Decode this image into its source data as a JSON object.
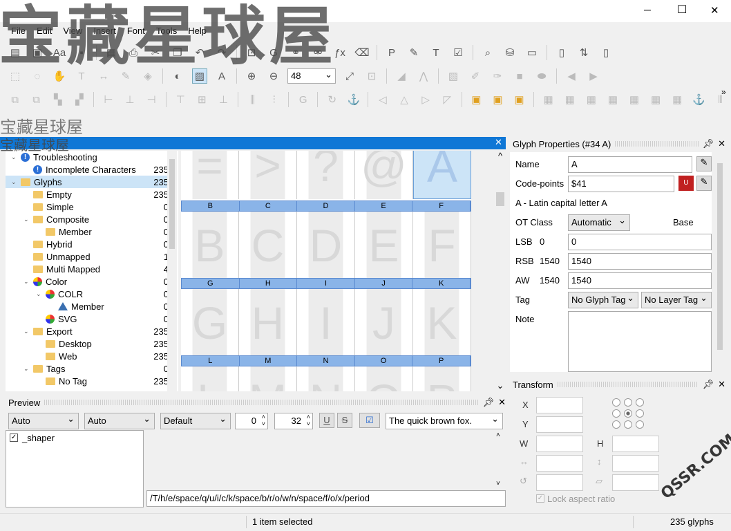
{
  "watermark": {
    "big": "宝藏星球屋",
    "small1": "宝藏星球屋",
    "small2": "宝藏星球屋",
    "corner": "QSSR.COM"
  },
  "window": {
    "min": "─",
    "max": "☐",
    "close": "✕"
  },
  "menu": [
    "File",
    "Edit",
    "View",
    "Insert",
    "Font",
    "Tools",
    "Help"
  ],
  "zoom": "48",
  "glyph_panel": {
    "close": "✕"
  },
  "tree": [
    {
      "label": "Troubleshooting",
      "count": "",
      "level": 1,
      "icon": "warning-icon"
    },
    {
      "label": "Incomplete Characters",
      "count": "235",
      "level": 2,
      "icon": "warning-icon"
    },
    {
      "label": "Glyphs",
      "count": "235",
      "level": 1,
      "icon": "folder-icon"
    },
    {
      "label": "Empty",
      "count": "235",
      "level": 2,
      "icon": "folder-icon"
    },
    {
      "label": "Simple",
      "count": "0",
      "level": 2,
      "icon": "folder-icon"
    },
    {
      "label": "Composite",
      "count": "0",
      "level": 2,
      "icon": "folder-icon"
    },
    {
      "label": "Member",
      "count": "0",
      "level": 3,
      "icon": "folder-icon"
    },
    {
      "label": "Hybrid",
      "count": "0",
      "level": 2,
      "icon": "folder-icon"
    },
    {
      "label": "Unmapped",
      "count": "1",
      "level": 2,
      "icon": "folder-icon"
    },
    {
      "label": "Multi Mapped",
      "count": "4",
      "level": 2,
      "icon": "folder-icon"
    },
    {
      "label": "Color",
      "count": "0",
      "level": 2,
      "icon": "color-icon"
    },
    {
      "label": "COLR",
      "count": "0",
      "level": 3,
      "icon": "color-icon"
    },
    {
      "label": "Member",
      "count": "0",
      "level": 4,
      "icon": "triangle-icon"
    },
    {
      "label": "SVG",
      "count": "0",
      "level": 3,
      "icon": "color-icon"
    },
    {
      "label": "Export",
      "count": "235",
      "level": 2,
      "icon": "folder-icon"
    },
    {
      "label": "Desktop",
      "count": "235",
      "level": 3,
      "icon": "folder-icon"
    },
    {
      "label": "Web",
      "count": "235",
      "level": 3,
      "icon": "folder-icon"
    },
    {
      "label": "Tags",
      "count": "0",
      "level": 2,
      "icon": "folder-icon"
    },
    {
      "label": "No Tag",
      "count": "235",
      "level": 3,
      "icon": "folder-icon"
    }
  ],
  "grid": {
    "row0_glyphs": [
      "=",
      ">",
      "?",
      "@",
      "A"
    ],
    "row1_labels": [
      "B",
      "C",
      "D",
      "E",
      "F"
    ],
    "row2_labels": [
      "G",
      "H",
      "I",
      "J",
      "K"
    ],
    "row3_labels": [
      "L",
      "M",
      "N",
      "O",
      "P"
    ]
  },
  "props": {
    "title": "Glyph Properties (#34 A)",
    "name_label": "Name",
    "name_value": "A",
    "cp_label": "Code-points",
    "cp_value": "$41",
    "desc": "A - Latin capital letter A",
    "otclass_label": "OT Class",
    "otclass_value": "Automatic",
    "base": "Base",
    "lsb_label": "LSB",
    "lsb_num": "0",
    "lsb_value": "0",
    "rsb_label": "RSB",
    "rsb_num": "1540",
    "rsb_value": "1540",
    "aw_label": "AW",
    "aw_num": "1540",
    "aw_value": "1540",
    "tag_label": "Tag",
    "glyph_tag": "No Glyph Tag",
    "layer_tag": "No Layer Tag",
    "note_label": "Note"
  },
  "transform": {
    "title": "Transform",
    "x": "X",
    "y": "Y",
    "w": "W",
    "h": "H",
    "lock": "Lock aspect ratio"
  },
  "preview": {
    "title": "Preview",
    "combo1": "Auto",
    "combo2": "Auto",
    "combo3": "Default",
    "num1": "0",
    "num2": "32",
    "u": "U",
    "s": "S",
    "text": "The quick brown fox.",
    "shaper": "_shaper",
    "glyph_string": "/T/h/e/space/q/u/i/c/k/space/b/r/o/w/n/space/f/o/x/period"
  },
  "status": {
    "selected": "1 item selected",
    "glyphs": "235 glyphs"
  }
}
